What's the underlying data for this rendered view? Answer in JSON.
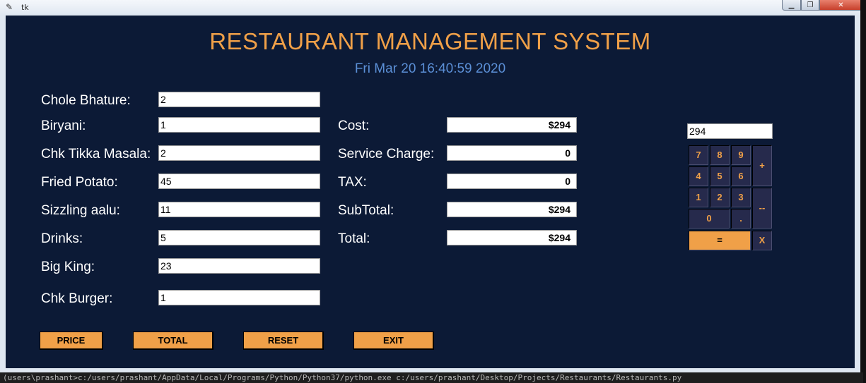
{
  "window": {
    "title": "tk"
  },
  "app": {
    "title": "RESTAURANT MANAGEMENT SYSTEM",
    "datetime": "Fri Mar 20 16:40:59 2020"
  },
  "items": [
    {
      "label": "Chole Bhature:",
      "value": "2"
    },
    {
      "label": "Biryani:",
      "value": "1"
    },
    {
      "label": "Chk Tikka Masala:",
      "value": "2"
    },
    {
      "label": "Fried Potato:",
      "value": "45"
    },
    {
      "label": "Sizzling aalu:",
      "value": "11"
    },
    {
      "label": "Drinks:",
      "value": "5"
    },
    {
      "label": "Big King:",
      "value": "23"
    },
    {
      "label": "Chk Burger:",
      "value": "1"
    }
  ],
  "results": [
    {
      "label": "Cost:",
      "value": "$294"
    },
    {
      "label": "Service Charge:",
      "value": "0"
    },
    {
      "label": "TAX:",
      "value": "0"
    },
    {
      "label": "SubTotal:",
      "value": "$294"
    },
    {
      "label": "Total:",
      "value": "$294"
    }
  ],
  "buttons": {
    "price": "PRICE",
    "total": "TOTAL",
    "reset": "RESET",
    "exit": "EXIT"
  },
  "calculator": {
    "display": "294",
    "keys": {
      "k7": "7",
      "k8": "8",
      "k9": "9",
      "plus": "+",
      "k4": "4",
      "k5": "5",
      "k6": "6",
      "k1": "1",
      "k2": "2",
      "k3": "3",
      "minus": "--",
      "k0": "0",
      "dot": ".",
      "equals": "=",
      "multiply": "X"
    }
  },
  "terminal": {
    "text": "(users\\prashant>c:/users/prashant/AppData/Local/Programs/Python/Python37/python.exe c:/users/prashant/Desktop/Projects/Restaurants/Restaurants.py"
  }
}
